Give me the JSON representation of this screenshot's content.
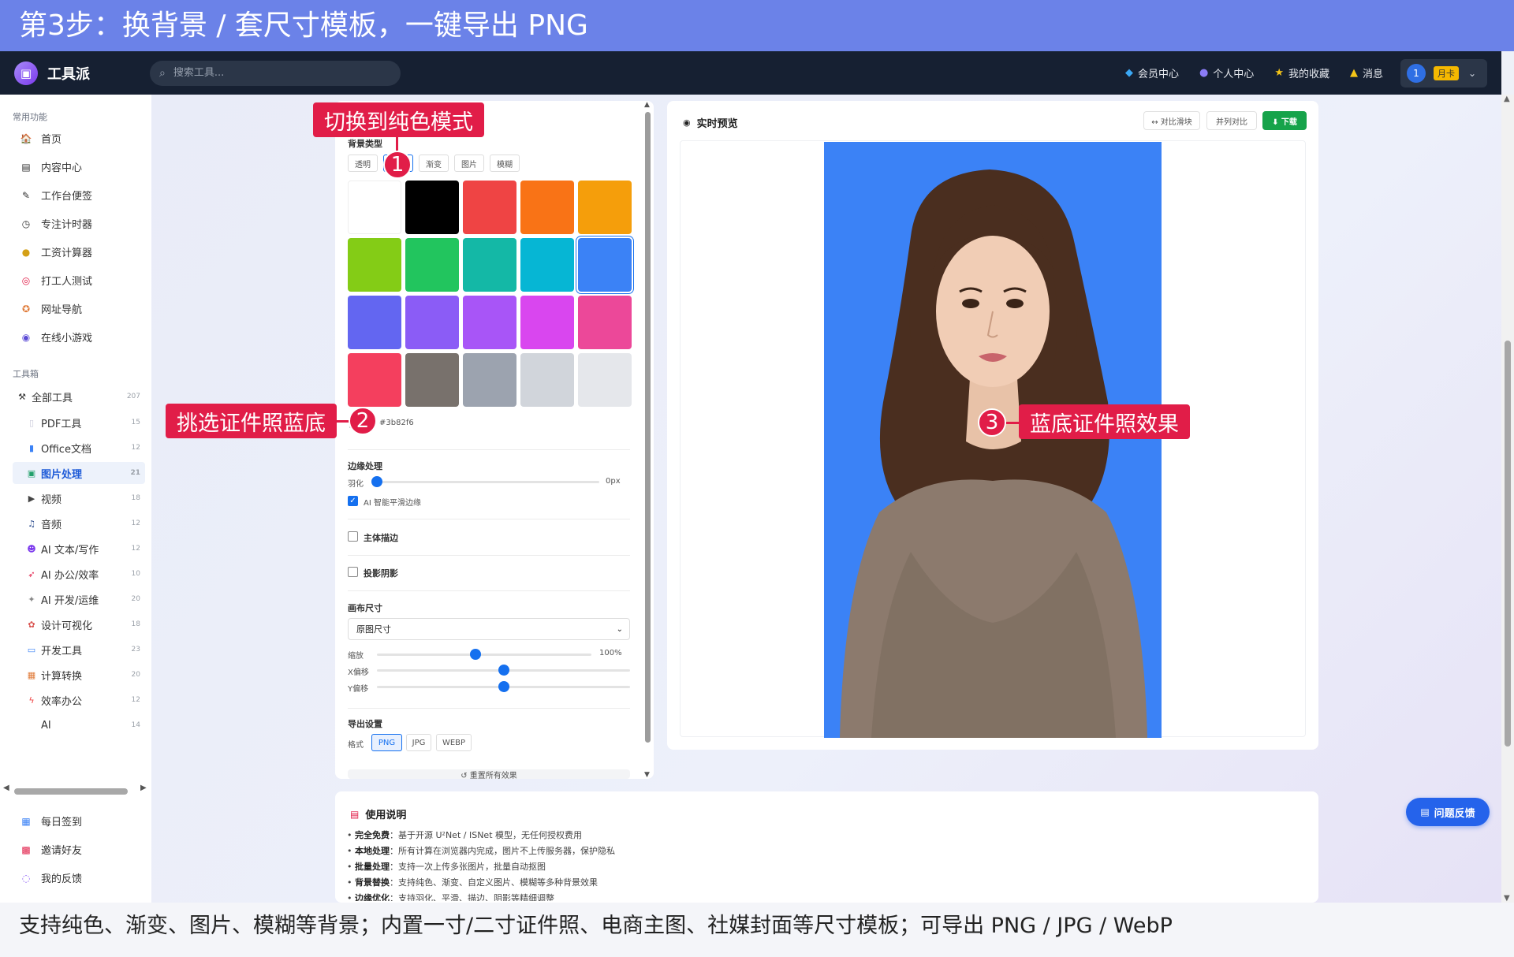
{
  "banner": {
    "title": "第3步：换背景 / 套尺寸模板，一键导出 PNG"
  },
  "navbar": {
    "logo_text": "工具派",
    "search_placeholder": "搜索工具...",
    "links": [
      {
        "icon": "diamond-icon",
        "label": "会员中心"
      },
      {
        "icon": "person-icon",
        "label": "个人中心"
      },
      {
        "icon": "star-icon",
        "label": "我的收藏"
      },
      {
        "icon": "bell-icon",
        "label": "消息"
      }
    ],
    "user": {
      "avatar_text": "1",
      "badge": "月卡"
    }
  },
  "sidebar": {
    "section_common": "常用功能",
    "common_items": [
      {
        "icon": "house-icon",
        "label": "首页"
      },
      {
        "icon": "document-icon",
        "label": "内容中心"
      },
      {
        "icon": "memo-icon",
        "label": "工作台便签"
      },
      {
        "icon": "timer-icon",
        "label": "专注计时器"
      },
      {
        "icon": "moneybag-icon",
        "label": "工资计算器"
      },
      {
        "icon": "target-icon",
        "label": "打工人测试"
      },
      {
        "icon": "compass-icon",
        "label": "网址导航"
      },
      {
        "icon": "gamepad-icon",
        "label": "在线小游戏"
      }
    ],
    "section_tools": "工具箱",
    "all_tools": {
      "label": "全部工具",
      "count": "207"
    },
    "tool_items": [
      {
        "icon": "pdf-icon",
        "label": "PDF工具",
        "count": "15",
        "active": false
      },
      {
        "icon": "office-icon",
        "label": "Office文档",
        "count": "12",
        "active": false
      },
      {
        "icon": "image-icon",
        "label": "图片处理",
        "count": "21",
        "active": true
      },
      {
        "icon": "video-icon",
        "label": "视频",
        "count": "18",
        "active": false
      },
      {
        "icon": "music-icon",
        "label": "音频",
        "count": "12",
        "active": false
      },
      {
        "icon": "robot-icon",
        "label": "AI 文本/写作",
        "count": "12",
        "active": false
      },
      {
        "icon": "rocket-icon",
        "label": "AI 办公/效率",
        "count": "10",
        "active": false
      },
      {
        "icon": "wrench-icon",
        "label": "AI 开发/运维",
        "count": "20",
        "active": false
      },
      {
        "icon": "palette-icon",
        "label": "设计可视化",
        "count": "18",
        "active": false
      },
      {
        "icon": "laptop-icon",
        "label": "开发工具",
        "count": "23",
        "active": false
      },
      {
        "icon": "abacus-icon",
        "label": "计算转换",
        "count": "20",
        "active": false
      },
      {
        "icon": "bolt-icon",
        "label": "效率办公",
        "count": "12",
        "active": false
      },
      {
        "icon": "",
        "label": "AI",
        "count": "14",
        "active": false
      }
    ],
    "bottom_items": [
      {
        "icon": "calendar-icon",
        "label": "每日签到"
      },
      {
        "icon": "gift-icon",
        "label": "邀请好友"
      },
      {
        "icon": "chat-icon",
        "label": "我的反馈"
      }
    ]
  },
  "settings": {
    "bg_type_label": "背景类型",
    "bg_tabs": [
      "透明",
      "纯色",
      "渐变",
      "图片",
      "模糊"
    ],
    "swatches": [
      "#ffffff",
      "#000000",
      "#ef4444",
      "#f97316",
      "#f59e0b",
      "#84cc16",
      "#22c55e",
      "#14b8a6",
      "#06b6d4",
      "#3b82f6",
      "#6366f1",
      "#8b5cf6",
      "#a855f7",
      "#d946ef",
      "#ec4899",
      "#f43f5e",
      "#78716c",
      "#9ca3af",
      "#d1d5db",
      "#e5e7eb"
    ],
    "custom_color": "#3b82f6",
    "edge_label": "边缘处理",
    "feather_label": "羽化",
    "feather_value": "0px",
    "feather_level": 0,
    "ai_smooth_label": "AI 智能平滑边缘",
    "ai_smooth_checked": true,
    "stroke_label": "主体描边",
    "shadow_label": "投影阴影",
    "canvas_size_label": "画布尺寸",
    "canvas_size_value": "原图尺寸",
    "scale_label": "缩放",
    "scale_value": "100%",
    "scale_level": 0.46,
    "xoffset_label": "X偏移",
    "xoffset_level": 0.5,
    "yoffset_label": "Y偏移",
    "yoffset_level": 0.5,
    "export_label": "导出设置",
    "format_label": "格式",
    "formats": [
      "PNG",
      "JPG",
      "WEBP"
    ],
    "format_active": "PNG",
    "reset_label": "↺ 重置所有效果"
  },
  "preview": {
    "title": "实时预览",
    "btn_compare_slider": "↔ 对比滑块",
    "btn_side_by_side": "并列对比",
    "btn_download": "⬇ 下载",
    "bg_color": "#3b82f6"
  },
  "info": {
    "title": "使用说明",
    "lines": [
      {
        "key": "完全免费",
        "text": "：基于开源 U²Net / ISNet 模型，无任何授权费用"
      },
      {
        "key": "本地处理",
        "text": "：所有计算在浏览器内完成，图片不上传服务器，保护隐私"
      },
      {
        "key": "批量处理",
        "text": "：支持一次上传多张图片，批量自动抠图"
      },
      {
        "key": "背景替换",
        "text": "：支持纯色、渐变、自定义图片、模糊等多种背景效果"
      },
      {
        "key": "边缘优化",
        "text": "：支持羽化、平滑、描边、阴影等精细调整"
      }
    ]
  },
  "feedback_label": "问题反馈",
  "callouts": [
    {
      "num": "1",
      "label": "切换到纯色模式"
    },
    {
      "num": "2",
      "label": "挑选证件照蓝底"
    },
    {
      "num": "3",
      "label": "蓝底证件照效果"
    }
  ],
  "caption": "支持纯色、渐变、图片、模糊等背景；内置一寸/二寸证件照、电商主图、社媒封面等尺寸模板；可导出 PNG / JPG / WebP",
  "colors": {
    "accent": "#1570ef",
    "callout": "#e11d48",
    "banner": "#6b82e8",
    "navbar": "#162032",
    "download": "#16a34a"
  }
}
